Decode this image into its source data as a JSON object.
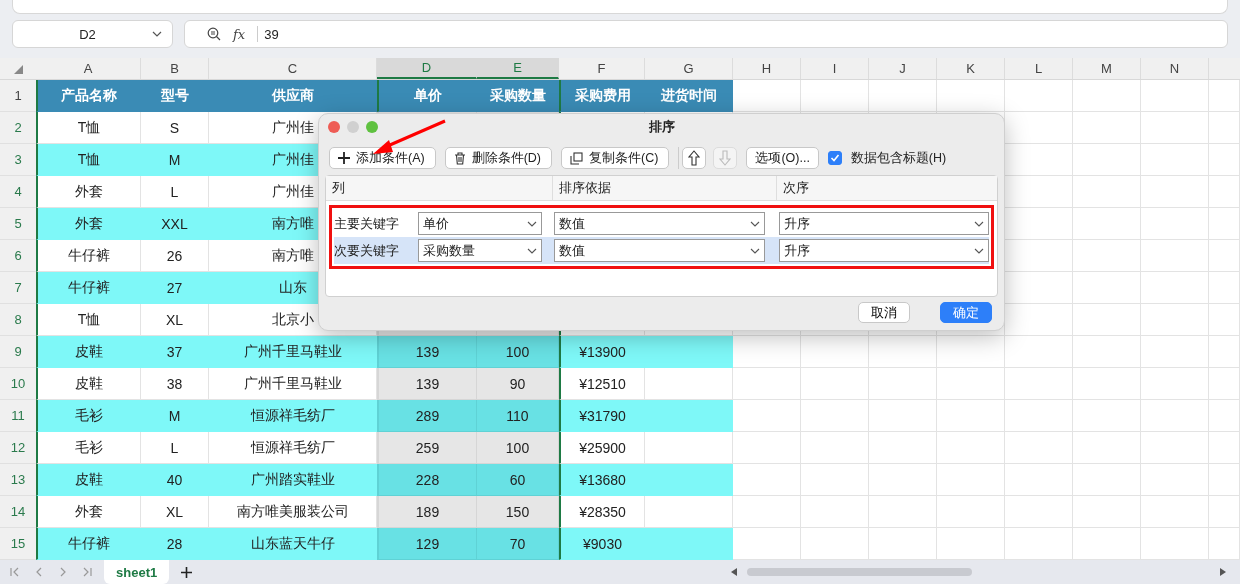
{
  "name_box": {
    "value": "D2"
  },
  "formula_bar": {
    "function_label": "fx",
    "value": "39"
  },
  "columns": [
    {
      "label": "A",
      "selected": false
    },
    {
      "label": "B",
      "selected": false
    },
    {
      "label": "C",
      "selected": false
    },
    {
      "label": "D",
      "selected": true
    },
    {
      "label": "E",
      "selected": true
    },
    {
      "label": "F",
      "selected": false
    },
    {
      "label": "G",
      "selected": false
    },
    {
      "label": "H",
      "selected": false
    },
    {
      "label": "I",
      "selected": false
    },
    {
      "label": "J",
      "selected": false
    },
    {
      "label": "K",
      "selected": false
    },
    {
      "label": "L",
      "selected": false
    },
    {
      "label": "M",
      "selected": false
    },
    {
      "label": "N",
      "selected": false
    }
  ],
  "rows": [
    {
      "number": "1",
      "kind": "header",
      "selected": false,
      "cells": [
        "产品名称",
        "型号",
        "供应商",
        "单价",
        "采购数量",
        "采购费用",
        "进货时间"
      ]
    },
    {
      "number": "2",
      "kind": "data",
      "selected": true,
      "shaded": false,
      "cells": [
        "T恤",
        "S",
        "广州佳"
      ]
    },
    {
      "number": "3",
      "kind": "data",
      "selected": true,
      "shaded": true,
      "cells": [
        "T恤",
        "M",
        "广州佳"
      ]
    },
    {
      "number": "4",
      "kind": "data",
      "selected": true,
      "shaded": false,
      "cells": [
        "外套",
        "L",
        "广州佳"
      ]
    },
    {
      "number": "5",
      "kind": "data",
      "selected": true,
      "shaded": true,
      "cells": [
        "外套",
        "XXL",
        "南方唯"
      ]
    },
    {
      "number": "6",
      "kind": "data",
      "selected": true,
      "shaded": false,
      "cells": [
        "牛仔裤",
        "26",
        "南方唯"
      ]
    },
    {
      "number": "7",
      "kind": "data",
      "selected": true,
      "shaded": true,
      "cells": [
        "牛仔裤",
        "27",
        "山东"
      ]
    },
    {
      "number": "8",
      "kind": "data",
      "selected": true,
      "shaded": false,
      "cells": [
        "T恤",
        "XL",
        "北京小"
      ]
    },
    {
      "number": "9",
      "kind": "data",
      "selected": true,
      "shaded": true,
      "cells": [
        "皮鞋",
        "37",
        "广州千里马鞋业",
        "139",
        "100",
        "¥13900"
      ]
    },
    {
      "number": "10",
      "kind": "data",
      "selected": true,
      "shaded": false,
      "cells": [
        "皮鞋",
        "38",
        "广州千里马鞋业",
        "139",
        "90",
        "¥12510"
      ]
    },
    {
      "number": "11",
      "kind": "data",
      "selected": true,
      "shaded": true,
      "cells": [
        "毛衫",
        "M",
        "恒源祥毛纺厂",
        "289",
        "110",
        "¥31790"
      ]
    },
    {
      "number": "12",
      "kind": "data",
      "selected": true,
      "shaded": false,
      "cells": [
        "毛衫",
        "L",
        "恒源祥毛纺厂",
        "259",
        "100",
        "¥25900"
      ]
    },
    {
      "number": "13",
      "kind": "data",
      "selected": true,
      "shaded": true,
      "cells": [
        "皮鞋",
        "40",
        "广州踏实鞋业",
        "228",
        "60",
        "¥13680"
      ]
    },
    {
      "number": "14",
      "kind": "data",
      "selected": true,
      "shaded": false,
      "cells": [
        "外套",
        "XL",
        "南方唯美服装公司",
        "189",
        "150",
        "¥28350"
      ]
    },
    {
      "number": "15",
      "kind": "data",
      "selected": true,
      "shaded": true,
      "cells": [
        "牛仔裤",
        "28",
        "山东蓝天牛仔",
        "129",
        "70",
        "¥9030"
      ]
    }
  ],
  "dialog": {
    "title": "排序",
    "toolbar": [
      {
        "kind": "add",
        "label": "添加条件(A)",
        "disabled": false
      },
      {
        "kind": "delete",
        "label": "删除条件(D)",
        "disabled": false
      },
      {
        "kind": "copy",
        "label": "复制条件(C)",
        "disabled": false
      },
      {
        "kind": "move_up",
        "disabled": false
      },
      {
        "kind": "move_down",
        "disabled": true
      },
      {
        "kind": "options",
        "label": "选项(O)...",
        "disabled": false
      }
    ],
    "header_checkbox": {
      "label": "数据包含标题(H)",
      "checked": true
    },
    "columns": [
      "列",
      "排序依据",
      "次序"
    ],
    "conditions": [
      {
        "label": "主要关键字",
        "column": "单价",
        "basis": "数值",
        "order": "升序",
        "selected": false
      },
      {
        "label": "次要关键字",
        "column": "采购数量",
        "basis": "数值",
        "order": "升序",
        "selected": true
      }
    ],
    "buttons": [
      {
        "label": "取消",
        "primary": false
      },
      {
        "label": "确定",
        "primary": true
      }
    ]
  },
  "sheet_tabs": [
    {
      "label": "sheet1",
      "selected": true
    }
  ]
}
